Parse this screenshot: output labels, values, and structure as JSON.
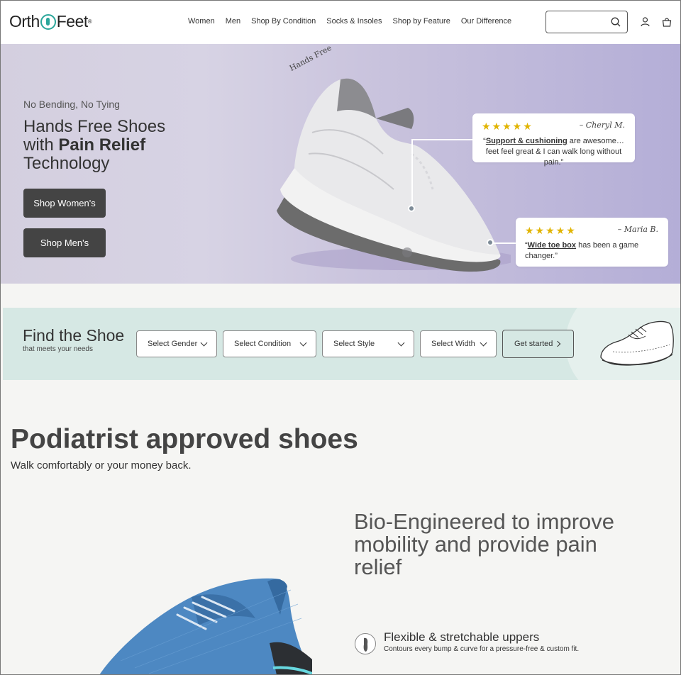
{
  "header": {
    "logo_left": "Orth",
    "logo_right": "Feet",
    "logo_mark": "®",
    "nav": [
      "Women",
      "Men",
      "Shop By Condition",
      "Socks & Insoles",
      "Shop by Feature",
      "Our Difference"
    ],
    "search_placeholder": "",
    "icons": [
      "search-icon",
      "user-icon",
      "bag-icon"
    ]
  },
  "hero": {
    "eyebrow": "No Bending, No Tying",
    "title_plain": "Hands Free Shoes with ",
    "title_bold": "Pain Relief",
    "title_end": " Technology",
    "buttons": [
      "Shop Women's",
      "Shop Men's"
    ],
    "shoe_tag": "Hands Free",
    "reviews": [
      {
        "stars": "★★★★★",
        "author": "– Cheryl M.",
        "pre": "“",
        "bold": "Support & cushioning",
        "text": " are awesome…feet feel great & I can walk long without pain.”"
      },
      {
        "stars": "★★★★★",
        "author": "– Maria B.",
        "pre": "“",
        "bold": "Wide toe box",
        "text": " has been a game changer.”"
      }
    ]
  },
  "finder": {
    "title": "Find the Shoe",
    "subtitle": "that meets your needs",
    "selects": [
      "Select Gender",
      "Select Condition",
      "Select Style",
      "Select Width"
    ],
    "cta": "Get started"
  },
  "section": {
    "heading": "Podiatrist approved shoes",
    "subheading": "Walk comfortably or your money back.",
    "bio_heading": "Bio-Engineered to improve mobility and provide pain relief",
    "feature_title": "Flexible & stretchable uppers",
    "feature_desc": "Contours every bump & curve for a pressure-free & custom fit."
  },
  "colors": {
    "brand_teal": "#2aa69a",
    "hero_bg": "#c9c3dd",
    "finder_bg": "#d6e8e4",
    "button_dark": "#444444",
    "star": "#e1b400"
  }
}
